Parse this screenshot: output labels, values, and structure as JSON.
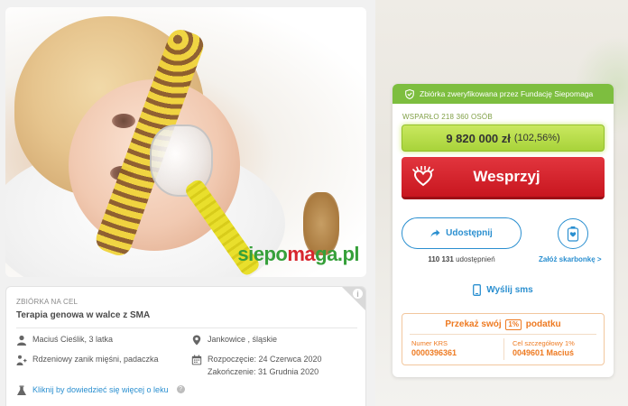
{
  "hero": {
    "logo_part1": "siepo",
    "logo_part2": "ma",
    "logo_part3": "ga.pl"
  },
  "campaign": {
    "label": "ZBIÓRKA NA CEL",
    "title": "Terapia genowa w walce z SMA",
    "person": "Maciuś Cieślik, 3 latka",
    "location": "Jankowice , śląskie",
    "disease": "Rdzeniowy zanik mięśni, padaczka",
    "start": "Rozpoczęcie: 24 Czerwca 2020",
    "end": "Zakończenie: 31 Grudnia 2020",
    "drug_link": "Kliknij by dowiedzieć się więcej o leku",
    "info_icon": "i",
    "help_icon": "?"
  },
  "donation": {
    "verified": "Zbiórka zweryfikowana przez Fundację Siepomaga",
    "donors": "WSPARŁO 218 360 OSÓB",
    "amount": "9 820 000 zł",
    "percent": "(102,56%)",
    "support_label": "Wesprzyj",
    "share_label": "Udostępnij",
    "shares_count": "110 131",
    "shares_suffix": "udostępnień",
    "piggy_label": "Załóż skarbonkę >",
    "sms_label": "Wyślij sms",
    "tax_title_pre": "Przekaż swój",
    "tax_badge": "1%",
    "tax_title_post": "podatku",
    "krs_label": "Numer KRS",
    "krs_value": "0000396361",
    "goal_label": "Cel szczegółowy 1%",
    "goal_value": "0049601 Maciuś"
  },
  "colors": {
    "accent_green": "#7dbe3f",
    "amount_green": "#b3da46",
    "support_red": "#d1202a",
    "link_blue": "#2a8fd0",
    "tax_orange": "#ee7a21"
  },
  "icons": [
    "star-icon",
    "info-icon",
    "person-icon",
    "location-pin-icon",
    "medical-icon",
    "calendar-icon",
    "flask-icon",
    "help-icon",
    "shield-check-icon",
    "heart-hand-icon",
    "share-arrow-icon",
    "piggy-bank-icon",
    "phone-icon"
  ]
}
